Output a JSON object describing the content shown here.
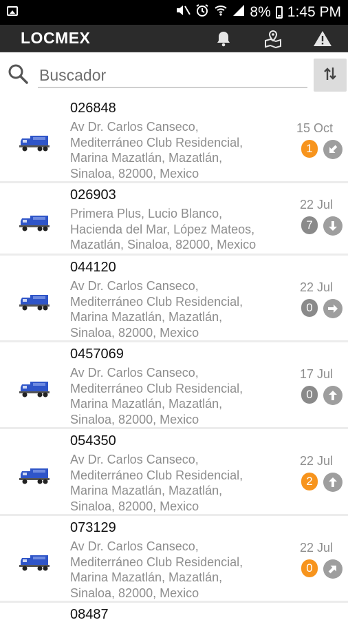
{
  "status_bar": {
    "battery": "8%",
    "time": "1:45 PM"
  },
  "app": {
    "title": "LOCMEX"
  },
  "search": {
    "placeholder": "Buscador"
  },
  "colors": {
    "badge_active": "#f7941d",
    "badge_inactive": "#8a8a8a",
    "direction": "#9e9e9e"
  },
  "icons": {
    "app_bar": [
      "bell-icon",
      "map-marker-icon",
      "warning-icon"
    ],
    "sort": "sort-icon",
    "row": "truck-icon"
  },
  "units": [
    {
      "id": "026848",
      "address": [
        "Av Dr. Carlos Canseco,",
        "Mediterráneo Club Residencial,",
        "Marina Mazatlán, Mazatlán,",
        "Sinaloa, 82000, Mexico"
      ],
      "date": "15 Oct",
      "count": "1",
      "count_state": "active",
      "direction": "down-left"
    },
    {
      "id": "026903",
      "address": [
        "Primera Plus, Lucio Blanco,",
        "Hacienda del Mar, López Mateos,",
        "Mazatlán, Sinaloa, 82000, Mexico"
      ],
      "date": "22 Jul",
      "count": "7",
      "count_state": "inactive",
      "direction": "down"
    },
    {
      "id": "044120",
      "address": [
        "Av Dr. Carlos Canseco,",
        "Mediterráneo Club Residencial,",
        "Marina Mazatlán, Mazatlán,",
        "Sinaloa, 82000, Mexico"
      ],
      "date": "22 Jul",
      "count": "0",
      "count_state": "inactive",
      "direction": "right"
    },
    {
      "id": "0457069",
      "address": [
        "Av Dr. Carlos Canseco,",
        "Mediterráneo Club Residencial,",
        "Marina Mazatlán, Mazatlán,",
        "Sinaloa, 82000, Mexico"
      ],
      "date": "17 Jul",
      "count": "0",
      "count_state": "inactive",
      "direction": "up"
    },
    {
      "id": "054350",
      "address": [
        "Av Dr. Carlos Canseco,",
        "Mediterráneo Club Residencial,",
        "Marina Mazatlán, Mazatlán,",
        "Sinaloa, 82000, Mexico"
      ],
      "date": "22 Jul",
      "count": "2",
      "count_state": "active",
      "direction": "up"
    },
    {
      "id": "073129",
      "address": [
        "Av Dr. Carlos Canseco,",
        "Mediterráneo Club Residencial,",
        "Marina Mazatlán, Mazatlán,",
        "Sinaloa, 82000, Mexico"
      ],
      "date": "22 Jul",
      "count": "0",
      "count_state": "active",
      "direction": "up-right"
    },
    {
      "id": "08487",
      "address": [],
      "date": "",
      "count": "",
      "count_state": "",
      "direction": ""
    }
  ]
}
